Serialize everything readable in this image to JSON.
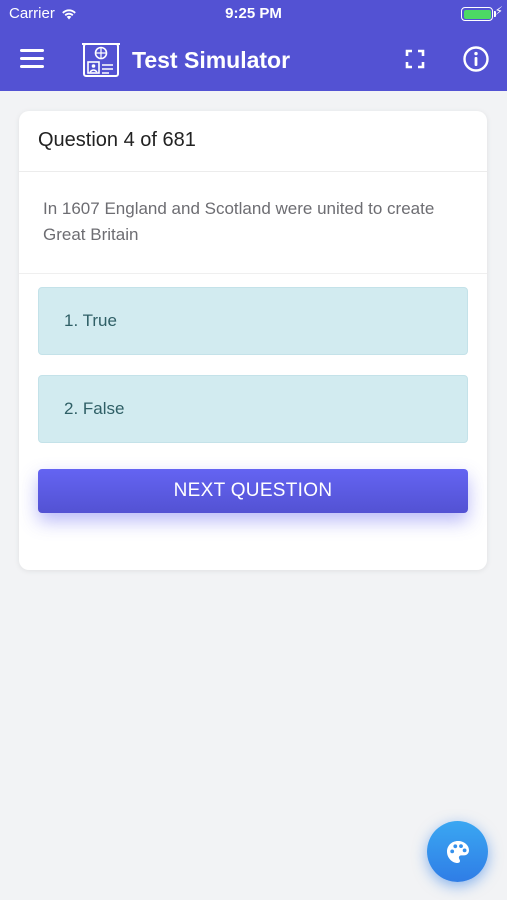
{
  "status_bar": {
    "carrier": "Carrier",
    "time": "9:25 PM",
    "battery_level": 1.0,
    "battery_color": "#4cd964"
  },
  "header": {
    "title": "Test Simulator",
    "background_color": "#5352d3",
    "icons": {
      "menu": "hamburger-menu-icon",
      "logo": "passport-id-card-logo",
      "fullscreen": "fullscreen-icon",
      "info": "info-icon"
    }
  },
  "quiz": {
    "question_counter": "Question 4 of 681",
    "question_text": "In 1607 England and Scotland were united to create Great Britain",
    "answers": [
      {
        "label": "1. True"
      },
      {
        "label": "2. False"
      }
    ],
    "answer_background_color": "#d2ebf0",
    "next_button_label": "NEXT QUESTION",
    "next_button_color": "#5f5fed"
  },
  "fab": {
    "icon": "palette-icon",
    "color": "#3490ec"
  }
}
